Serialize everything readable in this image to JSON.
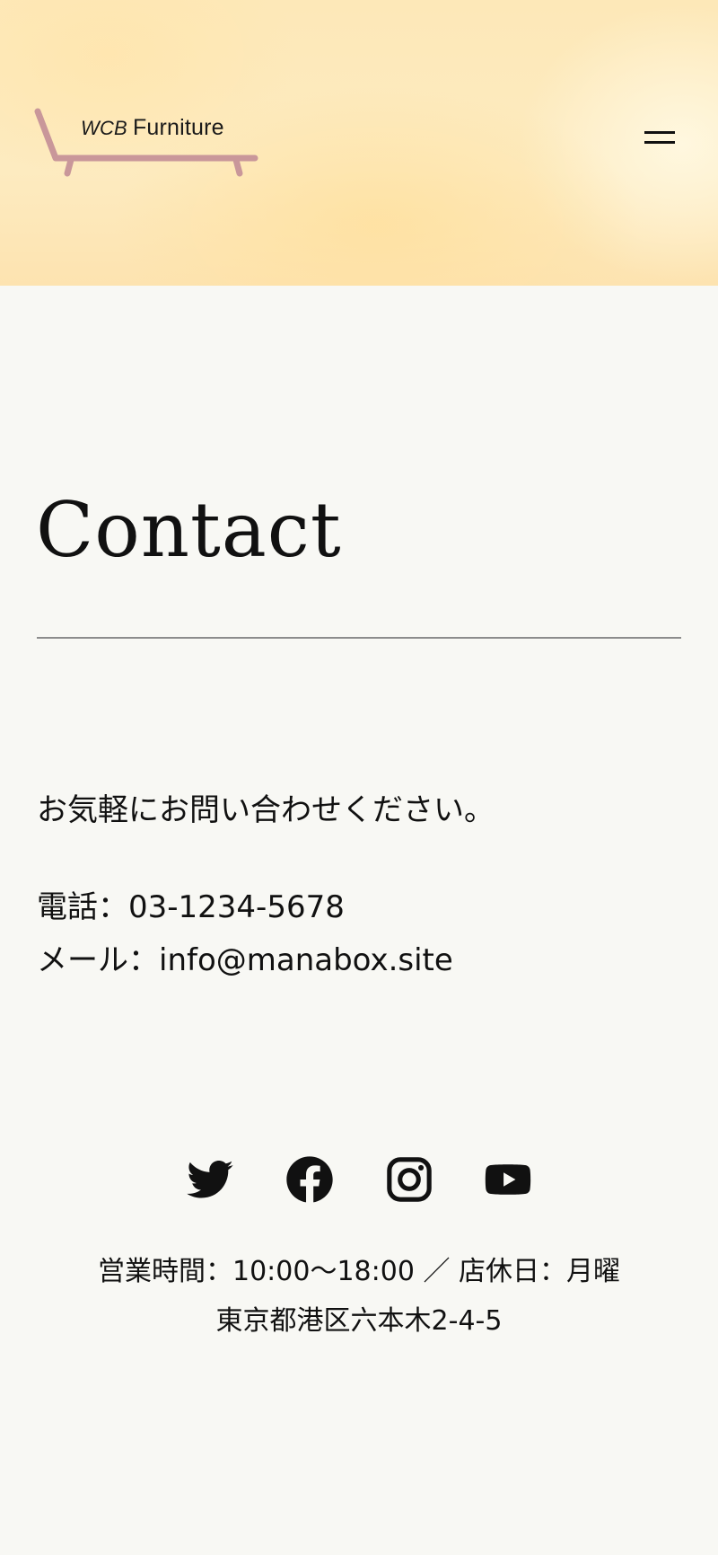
{
  "header": {
    "logo": {
      "brand_prefix": "WCB",
      "brand_name": "Furniture",
      "colors": {
        "chair": "#c9979a",
        "text": "#1a1a1a"
      }
    },
    "menu_icon": "hamburger-menu-icon"
  },
  "main": {
    "title": "Contact",
    "intro": "お気軽にお問い合わせください。",
    "phone": "電話：03-1234-5678",
    "email": "メール：info@manabox.site"
  },
  "footer": {
    "social_icons": [
      "twitter-icon",
      "facebook-icon",
      "instagram-icon",
      "youtube-icon"
    ],
    "hours": "営業時間：10:00〜18:00 ／ 店休日：月曜",
    "address": "東京都港区六本木2-4-5"
  },
  "colors": {
    "page_background": "#f8f8f4",
    "header_gradient": "#fde8b8",
    "divider": "#8c8c8c",
    "text": "#111111"
  }
}
